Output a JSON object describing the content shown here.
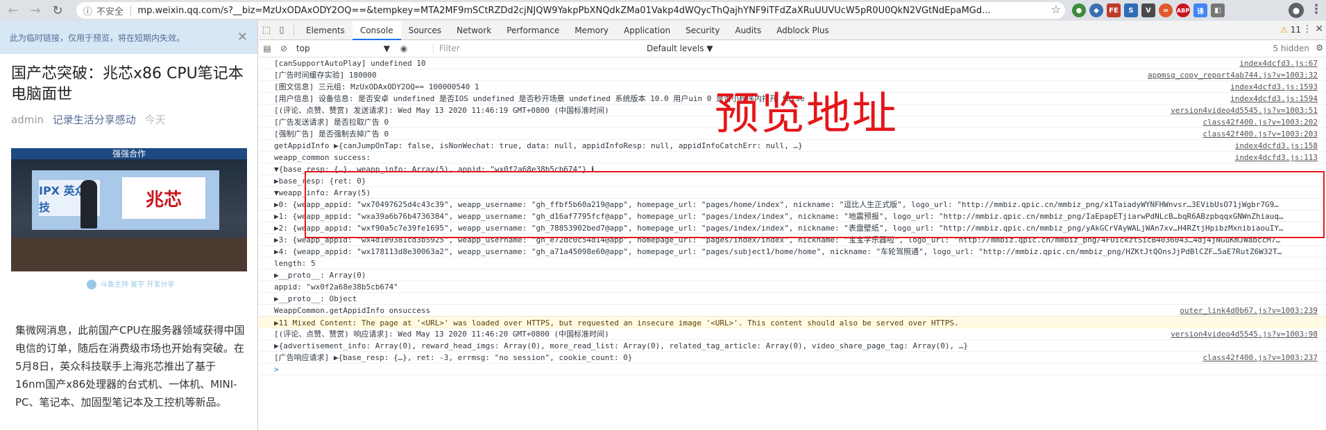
{
  "toolbar": {
    "back": "←",
    "forward": "→",
    "reload": "↻",
    "insecure_label": "不安全",
    "url": "mp.weixin.qq.com/s?__biz=MzUxODAxODY2OQ==&tempkey=MTA2MF9mSCtRZDd2cjNJQW9YakpPbXNQdkZMa01Vakp4dWQycThQajhYNF9iTFdZaXRuUUVUcW5pR0U0QkN2VGtNdEpaMGd...",
    "ext_icons": [
      "ext-green",
      "ext-dark",
      "ext-fe",
      "ext-s",
      "ext-v",
      "ext-orange",
      "ABP",
      "ext-translate",
      "ext-other"
    ],
    "ext_abp": "ABP",
    "ext_fe": "FE",
    "ext_s": "S",
    "ext_v": "V"
  },
  "article": {
    "notice": "此为临时链接，仅用于预览，将在短期内失效。",
    "title": "国产芯突破：兆芯x86 CPU笔记本电脑面世",
    "author": "admin",
    "source": "记录生活分享感动",
    "date": "今天",
    "photo_banner": "强强合作",
    "photo_left_logo": "IPX 英众科技",
    "photo_right_logo": "兆芯",
    "watermark": "斗鱼主持 鉴宇 开发分享",
    "body": "集微网消息，此前国产CPU在服务器领域获得中国电信的订单，随后在消费级市场也开始有突破。在5月8日，英众科技联手上海兆芯推出了基于16nm国产x86处理器的台式机、一体机、MINI-PC、笔记本、加固型笔记本及工控机等新品。"
  },
  "devtools": {
    "tabs": [
      "Elements",
      "Console",
      "Sources",
      "Network",
      "Performance",
      "Memory",
      "Application",
      "Security",
      "Audits",
      "Adblock Plus"
    ],
    "warn_count": "11",
    "context": "top",
    "filter_placeholder": "Filter",
    "levels": "Default levels ▼",
    "hidden": "5 hidden",
    "overlay_text": "预览地址",
    "lines": [
      {
        "text": "[canSupportAutoPlay] undefined 10",
        "src": "index4dcfd3.js:67"
      },
      {
        "text": "[广告时间缓存实验] 180000",
        "src": "appmsg_copy_report4ab744.js?v=1003:32"
      },
      {
        "text": "[图文信息] 三元组: MzUxODAxODY2OQ== 100000540 1",
        "src": "index4dcfd3.js:1593"
      },
      {
        "text": "[用户信息] 设备信息: 是否安卓 undefined 是否IOS undefined 是否秒开场景 undefined 系统版本 10.0 用户uin 0 是否小程序内打开 false",
        "src": "index4dcfd3.js:1594"
      },
      {
        "text": "[(评论、点赞、赞赏) 发送请求]:  Wed May 13 2020 11:46:19 GMT+0800 (中国标准时间)",
        "src": "version4video4d5545.js?v=1003:51"
      },
      {
        "text": "[广告发送请求] 是否拉取广告 0",
        "src": "class42f400.js?v=1003:202"
      },
      {
        "text": "[强制广告] 是否强制去掉广告 0",
        "src": "class42f400.js?v=1003:203"
      },
      {
        "text": "getAppidInfo ▶{canJumpOnTap: false, isNonWechat: true, data: null, appidInfoResp: null, appidInfoCatchErr: null, …}",
        "src": "index4dcfd3.js:158"
      },
      {
        "text": "weapp_common success:",
        "src": "index4dcfd3.js:113"
      },
      {
        "text": "▼{base_resp: {…}, weapp_info: Array(5), appid: \"wx0f2a68e38b5cb674\"} ℹ",
        "src": ""
      },
      {
        "text": "  ▶base_resp: {ret: 0}",
        "src": ""
      },
      {
        "text": "  ▼weapp_info: Array(5)",
        "src": ""
      },
      {
        "text": "    ▶0: {weapp_appid: \"wx70497625d4c43c39\", weapp_username: \"gh_ffbf5b60a219@app\", homepage_url: \"pages/home/index\", nickname: \"逗比人生正式版\", logo_url: \"http://mmbiz.qpic.cn/mmbiz_png/x1TaiadyWYNFHWnvsr…3EVibUsO71jWgbr7G9…",
        "src": ""
      },
      {
        "text": "    ▶1: {weapp_appid: \"wxa39a6b76b4736384\", weapp_username: \"gh_d16af7795fcf@app\", homepage_url: \"pages/index/index\", nickname: \"地震预报\", logo_url: \"http://mmbiz.qpic.cn/mmbiz_png/IaEpapETjiarwPdNLcB…bqR6ABzpbqqxGNWnZhiauq…",
        "src": ""
      },
      {
        "text": "    ▶2: {weapp_appid: \"wxf90a5c7e39fe1695\", weapp_username: \"gh_78853902bed7@app\", homepage_url: \"pages/index/index\", nickname: \"表盘壁纸\", logo_url: \"http://mmbiz.qpic.cn/mmbiz_png/yAkGCrVAyWALjWAn7xv…H4RZtjHpibzMxnibiaouIY…",
        "src": ""
      },
      {
        "text": "    ▶3: {weapp_appid: \"wx4d1e9381cd3b5925\", weapp_username: \"gh_e72dc0c54d14@app\", homepage_url: \"pages/index/index\", nickname: \"宝宝学乐器啦\", logo_url: \"http://mmbiz.qpic.cn/mmbiz_png/4FUickztSicB4036043…4dj4jNGuKmJWabccM7…",
        "src": ""
      },
      {
        "text": "    ▶4: {weapp_appid: \"wx178113d8e30063a2\", weapp_username: \"gh_a71a45098e60@app\", homepage_url: \"pages/subject1/home/home\", nickname: \"车轮驾照通\", logo_url: \"http://mmbiz.qpic.cn/mmbiz_png/HZKtJtQOnsJjPdBlCZF…5aE7RutZ6W32T…",
        "src": ""
      },
      {
        "text": "      length: 5",
        "src": ""
      },
      {
        "text": "    ▶__proto__: Array(0)",
        "src": ""
      },
      {
        "text": "    appid: \"wx0f2a68e38b5cb674\"",
        "src": ""
      },
      {
        "text": "  ▶__proto__: Object",
        "src": ""
      },
      {
        "text": "WeappCommon.getAppidInfo onsuccess",
        "src": "outer_link4d0b67.js?v=1003:239"
      },
      {
        "text": "▶11 Mixed Content: The page at '<URL>' was loaded over HTTPS, but requested an insecure image '<URL>'. This content should also be served over HTTPS.",
        "src": ""
      },
      {
        "text": "[(评论、点赞、赞赏) 响应请求]:  Wed May 13 2020 11:46:20 GMT+0800 (中国标准时间)",
        "src": "version4video4d5545.js?v=1003:98"
      },
      {
        "text": "▶{advertisement_info: Array(0), reward_head_imgs: Array(0), more_read_list: Array(0), related_tag_article: Array(0), video_share_page_tag: Array(0), …}",
        "src": ""
      },
      {
        "text": "[广告响应请求] ▶{base_resp: {…}, ret: -3, errmsg: \"no session\", cookie_count: 0}",
        "src": "class42f400.js?v=1003:237"
      }
    ],
    "prompt": ">"
  }
}
